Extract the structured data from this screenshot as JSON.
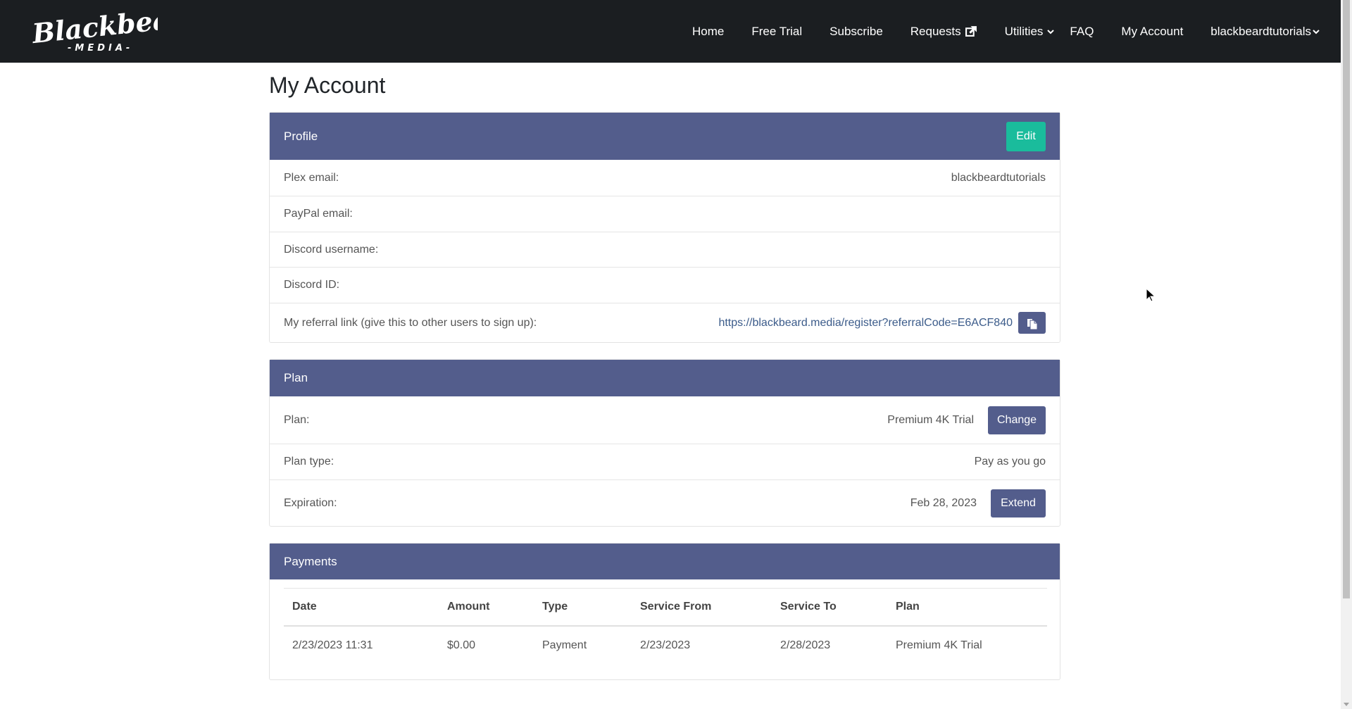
{
  "nav": {
    "brand": "Blackbeard MEDIA",
    "items": [
      {
        "label": "Home"
      },
      {
        "label": "Free Trial"
      },
      {
        "label": "Subscribe"
      },
      {
        "label": "Requests"
      },
      {
        "label": "Utilities"
      },
      {
        "label": "FAQ"
      },
      {
        "label": "My Account"
      },
      {
        "label": "blackbeardtutorials"
      }
    ],
    "colors": {
      "background": "#1b1e21",
      "text": "#ffffff"
    }
  },
  "page": {
    "title": "My Account"
  },
  "profile": {
    "header": "Profile",
    "edit_label": "Edit",
    "rows": [
      {
        "label": "Plex email:",
        "value": "blackbeardtutorials"
      },
      {
        "label": "PayPal email:",
        "value": ""
      },
      {
        "label": "Discord username:",
        "value": ""
      },
      {
        "label": "Discord ID:",
        "value": ""
      },
      {
        "label": "My referral link (give this to other users to sign up):",
        "value": "https://blackbeard.media/register?referralCode=E6ACF840"
      }
    ]
  },
  "plan": {
    "header": "Plan",
    "rows": [
      {
        "label": "Plan:",
        "value": "Premium 4K Trial",
        "button": "Change"
      },
      {
        "label": "Plan type:",
        "value": "Pay as you go"
      },
      {
        "label": "Expiration:",
        "value": "Feb 28, 2023",
        "button": "Extend"
      }
    ]
  },
  "payments": {
    "header": "Payments",
    "columns": [
      "Date",
      "Amount",
      "Type",
      "Service From",
      "Service To",
      "Plan"
    ],
    "rows": [
      [
        "2/23/2023 11:31",
        "$0.00",
        "Payment",
        "2/23/2023",
        "2/28/2023",
        "Premium 4K Trial"
      ]
    ]
  },
  "colors": {
    "card_header": "#535d8c",
    "edit_button": "#1abc9c",
    "link": "#3b5b8a"
  }
}
